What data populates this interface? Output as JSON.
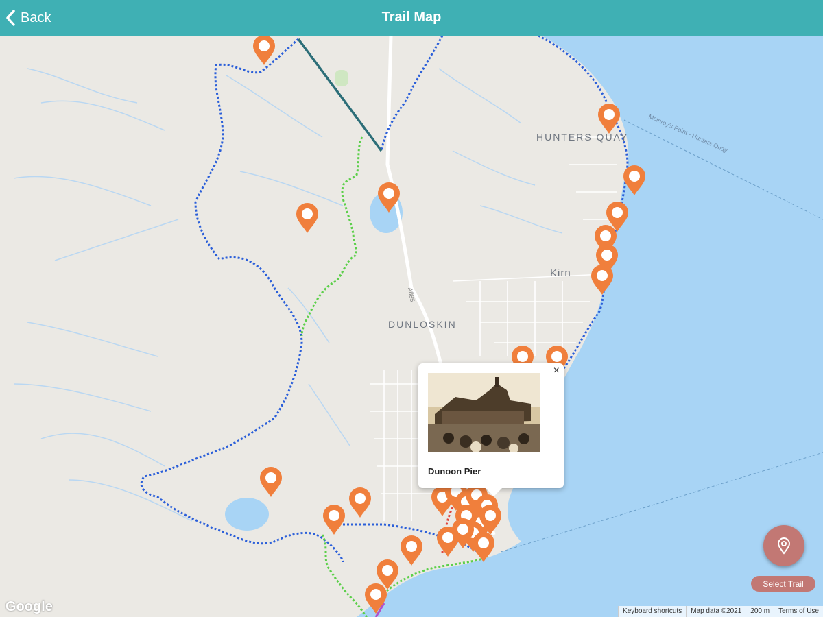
{
  "header": {
    "back_label": "Back",
    "title": "Trail Map"
  },
  "map": {
    "place_labels": {
      "hunters_quay": "HUNTERS QUAY",
      "kirn": "Kirn",
      "dunloskin": "DUNLOSKIN"
    },
    "ferry_label": "McInroy's Point - Hunters Quay",
    "road_label": "A885"
  },
  "popup": {
    "title": "Dunoon Pier",
    "close": "×"
  },
  "actions": {
    "select_trail": "Select Trail"
  },
  "attribution": {
    "logo": "Google",
    "shortcuts": "Keyboard shortcuts",
    "map_data": "Map data ©2021",
    "scale": "200 m",
    "terms": "Terms of Use"
  },
  "colors": {
    "header": "#3fb0b4",
    "water": "#a8d4f5",
    "marker": "#f07f3c",
    "trail_blue": "#2b5fd9",
    "trail_green": "#5ccf4a",
    "fab": "#c27874"
  },
  "icons": {
    "back": "chevron-left-icon",
    "marker": "map-pin-icon",
    "fab": "location-pin-icon"
  }
}
